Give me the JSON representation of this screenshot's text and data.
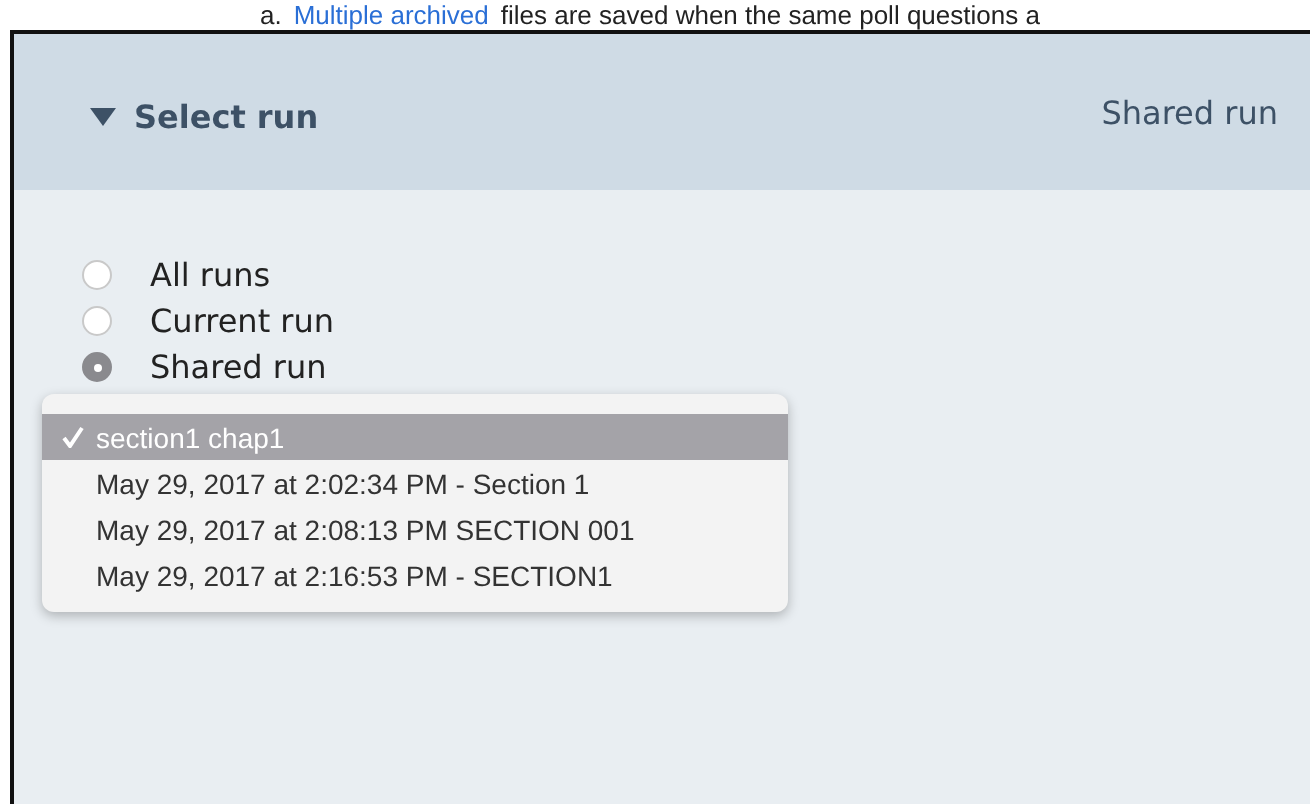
{
  "note": {
    "marker": "a.",
    "link": "Multiple archived",
    "text": "files are saved when the same poll questions a"
  },
  "panel": {
    "title": "Select run",
    "expanded": true,
    "summary": "Shared run"
  },
  "radios": [
    {
      "label": "All runs",
      "selected": false
    },
    {
      "label": "Current run",
      "selected": false
    },
    {
      "label": "Shared run",
      "selected": true
    }
  ],
  "menu": {
    "items": [
      {
        "label": "section1 chap1",
        "selected": true
      },
      {
        "label": "May 29, 2017 at 2:02:34 PM - Section 1",
        "selected": false
      },
      {
        "label": "May 29, 2017 at 2:08:13 PM SECTION 001",
        "selected": false
      },
      {
        "label": "May 29, 2017 at 2:16:53 PM - SECTION1",
        "selected": false
      }
    ]
  }
}
